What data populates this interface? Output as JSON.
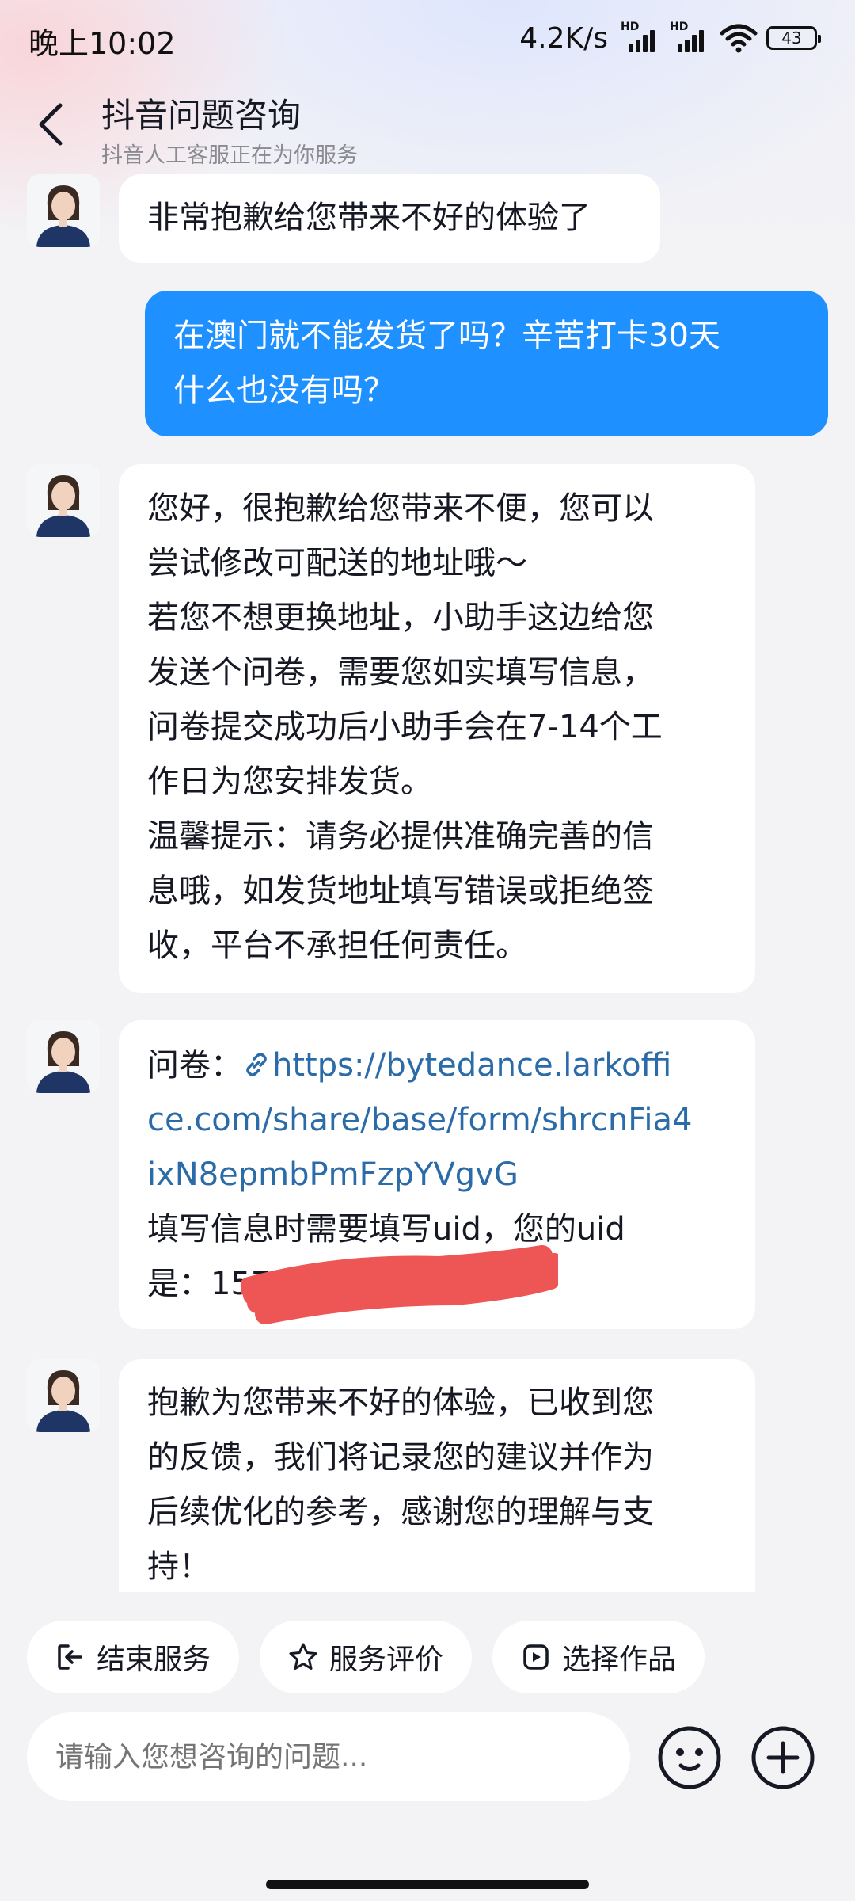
{
  "status_bar": {
    "time": "晚上10:02",
    "net_speed": "4.2K/s",
    "sim1_label": "HD",
    "sim2_label": "HD",
    "battery": "43"
  },
  "header": {
    "title": "抖音问题咨询",
    "subtitle": "抖音人工客服正在为你服务"
  },
  "messages": {
    "m1": {
      "lines": [
        "非常抱歉给您带来不好的体验了"
      ]
    },
    "m2": {
      "lines": [
        "在澳门就不能发货了吗？辛苦打卡30天",
        "什么也没有吗？"
      ]
    },
    "m3": {
      "lines": [
        "您好，很抱歉给您带来不便，您可以",
        "尝试修改可配送的地址哦～",
        "若您不想更换地址，小助手这边给您",
        "发送个问卷，需要您如实填写信息，",
        "问卷提交成功后小助手会在7-14个工",
        "作日为您安排发货。",
        "温馨提示：请务必提供准确完善的信",
        "息哦，如发货地址填写错误或拒绝签",
        "收，平台不承担任何责任。"
      ]
    },
    "m4": {
      "prefix": "问卷：",
      "link_lines": [
        "https://bytedance.larkoffi",
        "ce.com/share/base/form/shrcnFia4",
        "ixN8epmbPmFzpYVgvG"
      ],
      "lines": [
        "填写信息时需要填写uid，您的uid",
        "是：157"
      ]
    },
    "m5": {
      "lines": [
        "抱歉为您带来不好的体验，已收到您",
        "的反馈，我们将记录您的建议并作为",
        "后续优化的参考，感谢您的理解与支",
        "持！"
      ]
    }
  },
  "quick_actions": {
    "end_service": "结束服务",
    "rate_service": "服务评价",
    "select_work": "选择作品"
  },
  "input": {
    "placeholder": "请输入您想咨询的问题..."
  },
  "colors": {
    "user_bubble": "#1e90ff",
    "link": "#2b6ba8",
    "redaction": "#ee5555"
  }
}
